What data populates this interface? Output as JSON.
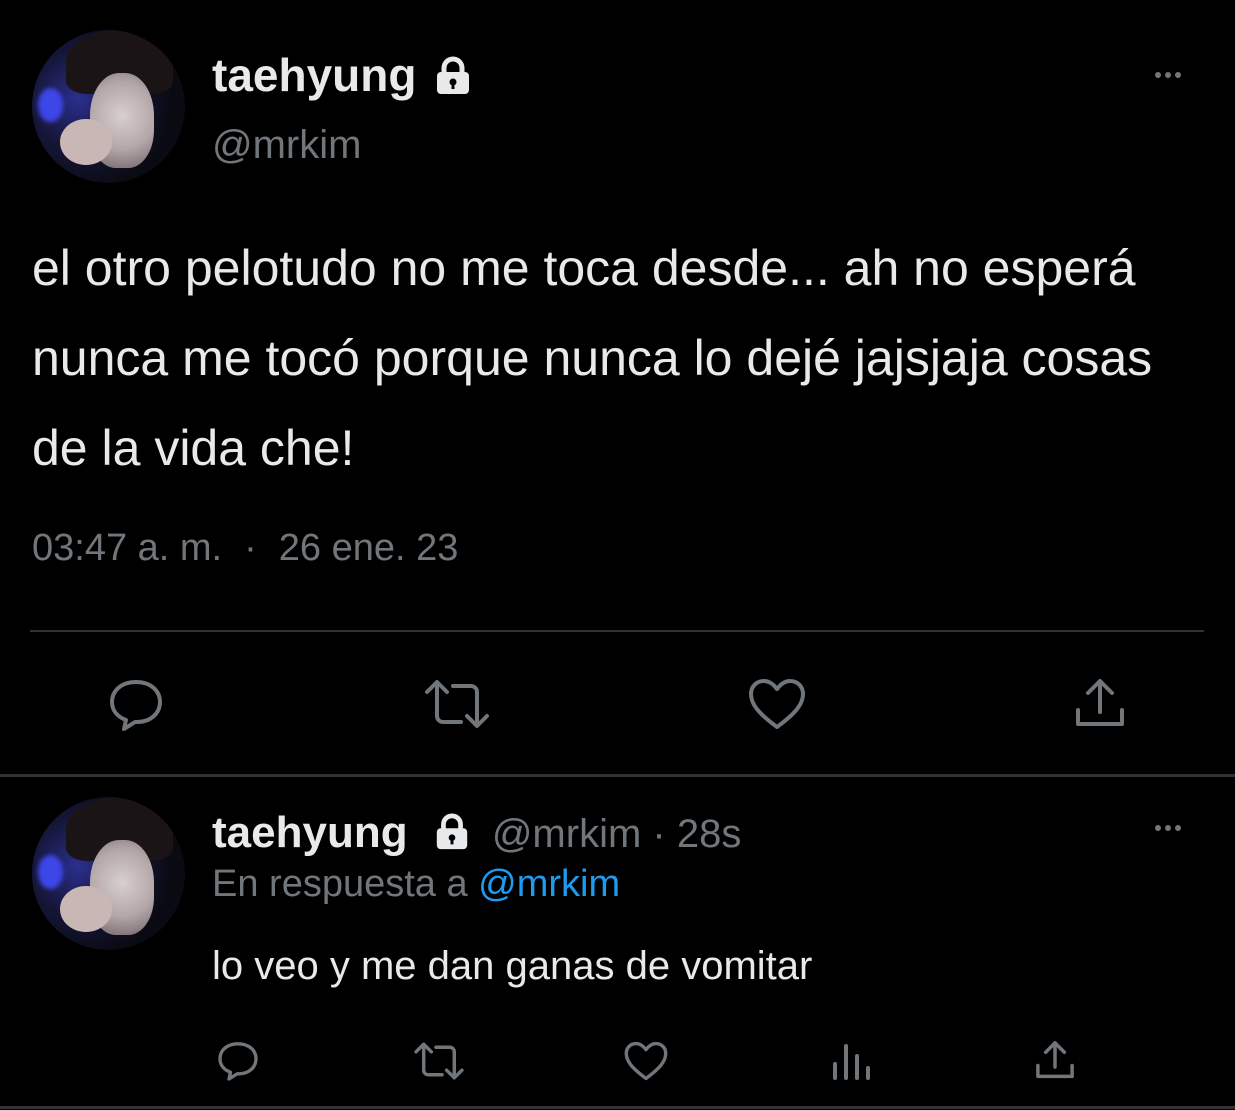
{
  "main_tweet": {
    "author_name": "taehyung",
    "handle": "@mrkim",
    "text": "el otro pelotudo no me toca desde... ah no esperá nunca me tocó porque nunca lo dejé jajsjaja cosas de la vida che!",
    "time": "03:47 a. m.",
    "separator": "·",
    "date": "26 ene. 23"
  },
  "reply_tweet": {
    "author_name": "taehyung",
    "handle": "@mrkim",
    "separator": "·",
    "age": "28s",
    "reply_prefix": "En respuesta a",
    "reply_mention": "@mrkim",
    "text": "lo veo y me dan ganas de vomitar"
  },
  "icons": {
    "lock": "lock-icon",
    "more": "more-options-icon",
    "reply": "reply-icon",
    "retweet": "retweet-icon",
    "like": "like-heart-icon",
    "share": "share-icon",
    "views": "views-chart-icon"
  },
  "colors": {
    "background": "#000000",
    "primary_text": "#e7e9ea",
    "secondary_text": "#71767b",
    "link": "#1d9bf0",
    "divider": "#2f3336"
  }
}
